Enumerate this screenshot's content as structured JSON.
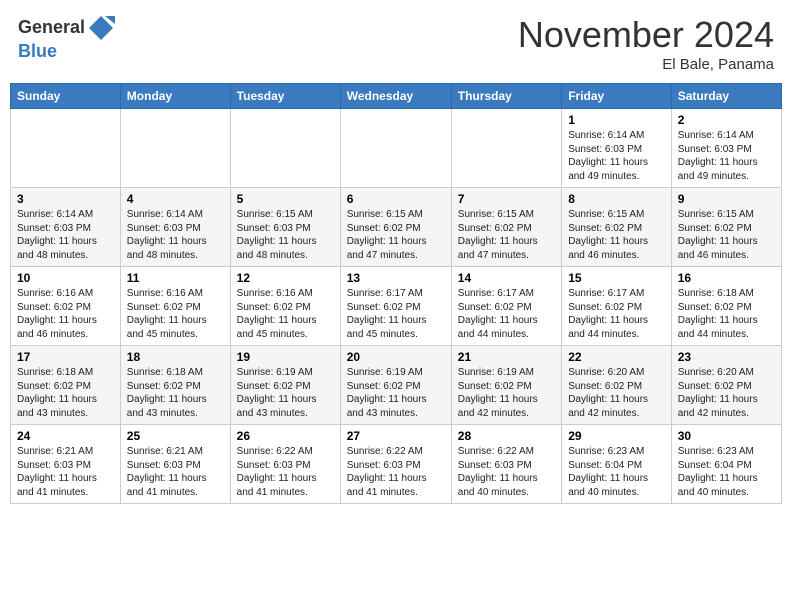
{
  "header": {
    "logo_line1": "General",
    "logo_line2": "Blue",
    "month_title": "November 2024",
    "location": "El Bale, Panama"
  },
  "days_of_week": [
    "Sunday",
    "Monday",
    "Tuesday",
    "Wednesday",
    "Thursday",
    "Friday",
    "Saturday"
  ],
  "weeks": [
    [
      {
        "day": "",
        "info": ""
      },
      {
        "day": "",
        "info": ""
      },
      {
        "day": "",
        "info": ""
      },
      {
        "day": "",
        "info": ""
      },
      {
        "day": "",
        "info": ""
      },
      {
        "day": "1",
        "info": "Sunrise: 6:14 AM\nSunset: 6:03 PM\nDaylight: 11 hours and 49 minutes."
      },
      {
        "day": "2",
        "info": "Sunrise: 6:14 AM\nSunset: 6:03 PM\nDaylight: 11 hours and 49 minutes."
      }
    ],
    [
      {
        "day": "3",
        "info": "Sunrise: 6:14 AM\nSunset: 6:03 PM\nDaylight: 11 hours and 48 minutes."
      },
      {
        "day": "4",
        "info": "Sunrise: 6:14 AM\nSunset: 6:03 PM\nDaylight: 11 hours and 48 minutes."
      },
      {
        "day": "5",
        "info": "Sunrise: 6:15 AM\nSunset: 6:03 PM\nDaylight: 11 hours and 48 minutes."
      },
      {
        "day": "6",
        "info": "Sunrise: 6:15 AM\nSunset: 6:02 PM\nDaylight: 11 hours and 47 minutes."
      },
      {
        "day": "7",
        "info": "Sunrise: 6:15 AM\nSunset: 6:02 PM\nDaylight: 11 hours and 47 minutes."
      },
      {
        "day": "8",
        "info": "Sunrise: 6:15 AM\nSunset: 6:02 PM\nDaylight: 11 hours and 46 minutes."
      },
      {
        "day": "9",
        "info": "Sunrise: 6:15 AM\nSunset: 6:02 PM\nDaylight: 11 hours and 46 minutes."
      }
    ],
    [
      {
        "day": "10",
        "info": "Sunrise: 6:16 AM\nSunset: 6:02 PM\nDaylight: 11 hours and 46 minutes."
      },
      {
        "day": "11",
        "info": "Sunrise: 6:16 AM\nSunset: 6:02 PM\nDaylight: 11 hours and 45 minutes."
      },
      {
        "day": "12",
        "info": "Sunrise: 6:16 AM\nSunset: 6:02 PM\nDaylight: 11 hours and 45 minutes."
      },
      {
        "day": "13",
        "info": "Sunrise: 6:17 AM\nSunset: 6:02 PM\nDaylight: 11 hours and 45 minutes."
      },
      {
        "day": "14",
        "info": "Sunrise: 6:17 AM\nSunset: 6:02 PM\nDaylight: 11 hours and 44 minutes."
      },
      {
        "day": "15",
        "info": "Sunrise: 6:17 AM\nSunset: 6:02 PM\nDaylight: 11 hours and 44 minutes."
      },
      {
        "day": "16",
        "info": "Sunrise: 6:18 AM\nSunset: 6:02 PM\nDaylight: 11 hours and 44 minutes."
      }
    ],
    [
      {
        "day": "17",
        "info": "Sunrise: 6:18 AM\nSunset: 6:02 PM\nDaylight: 11 hours and 43 minutes."
      },
      {
        "day": "18",
        "info": "Sunrise: 6:18 AM\nSunset: 6:02 PM\nDaylight: 11 hours and 43 minutes."
      },
      {
        "day": "19",
        "info": "Sunrise: 6:19 AM\nSunset: 6:02 PM\nDaylight: 11 hours and 43 minutes."
      },
      {
        "day": "20",
        "info": "Sunrise: 6:19 AM\nSunset: 6:02 PM\nDaylight: 11 hours and 43 minutes."
      },
      {
        "day": "21",
        "info": "Sunrise: 6:19 AM\nSunset: 6:02 PM\nDaylight: 11 hours and 42 minutes."
      },
      {
        "day": "22",
        "info": "Sunrise: 6:20 AM\nSunset: 6:02 PM\nDaylight: 11 hours and 42 minutes."
      },
      {
        "day": "23",
        "info": "Sunrise: 6:20 AM\nSunset: 6:02 PM\nDaylight: 11 hours and 42 minutes."
      }
    ],
    [
      {
        "day": "24",
        "info": "Sunrise: 6:21 AM\nSunset: 6:03 PM\nDaylight: 11 hours and 41 minutes."
      },
      {
        "day": "25",
        "info": "Sunrise: 6:21 AM\nSunset: 6:03 PM\nDaylight: 11 hours and 41 minutes."
      },
      {
        "day": "26",
        "info": "Sunrise: 6:22 AM\nSunset: 6:03 PM\nDaylight: 11 hours and 41 minutes."
      },
      {
        "day": "27",
        "info": "Sunrise: 6:22 AM\nSunset: 6:03 PM\nDaylight: 11 hours and 41 minutes."
      },
      {
        "day": "28",
        "info": "Sunrise: 6:22 AM\nSunset: 6:03 PM\nDaylight: 11 hours and 40 minutes."
      },
      {
        "day": "29",
        "info": "Sunrise: 6:23 AM\nSunset: 6:04 PM\nDaylight: 11 hours and 40 minutes."
      },
      {
        "day": "30",
        "info": "Sunrise: 6:23 AM\nSunset: 6:04 PM\nDaylight: 11 hours and 40 minutes."
      }
    ]
  ]
}
